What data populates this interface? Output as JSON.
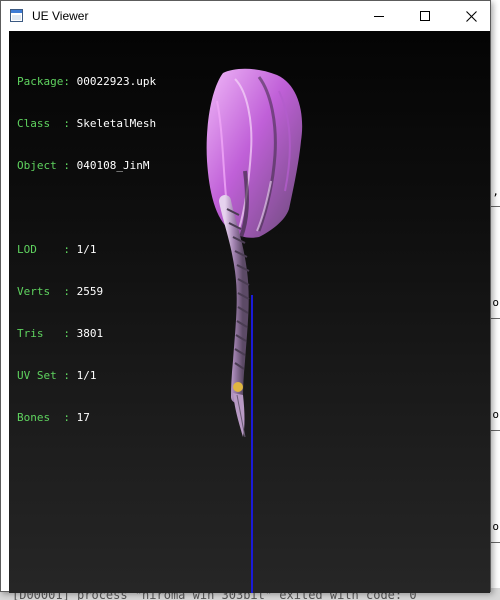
{
  "window": {
    "title": "UE Viewer"
  },
  "controls": {
    "minimize": "minimize",
    "maximize": "maximize",
    "close": "close"
  },
  "info": {
    "package": {
      "label": "Package",
      "value": "00022923.upk"
    },
    "class": {
      "label": "Class  ",
      "value": "SkeletalMesh"
    },
    "object": {
      "label": "Object ",
      "value": "040108_JinM"
    },
    "lod": {
      "label": "LOD    ",
      "value": "1/1"
    },
    "verts": {
      "label": "Verts  ",
      "value": "2559"
    },
    "tris": {
      "label": "Tris   ",
      "value": "3801"
    },
    "uvset": {
      "label": "UV Set ",
      "value": "1/1"
    },
    "bones": {
      "label": "Bones  ",
      "value": "17"
    }
  },
  "background_console": {
    "status_text": "[D00001] process \"hiroma win 303bit\" exited with code: 0"
  },
  "colors": {
    "label_green": "#5fd35f",
    "value_white": "#ffffff",
    "axis_blue": "#1a1ad8",
    "hair_pink": "#d070e0"
  }
}
